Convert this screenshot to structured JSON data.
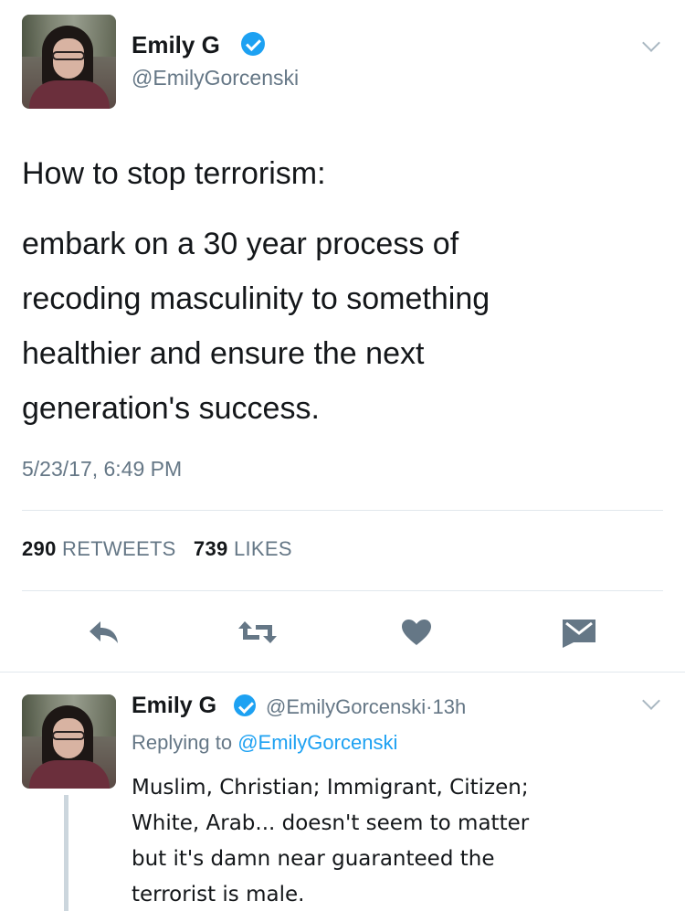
{
  "main_tweet": {
    "author": {
      "name": "Emily G",
      "handle": "@EmilyGorcenski",
      "verified": true
    },
    "title_line": "How to stop terrorism:",
    "body_lines": [
      "embark on a 30 year process of",
      "recoding masculinity to something",
      "healthier and ensure the next",
      "generation's success."
    ],
    "timestamp": "5/23/17, 6:49 PM",
    "stats": {
      "retweets_count": "290",
      "retweets_label": "RETWEETS",
      "likes_count": "739",
      "likes_label": "LIKES"
    },
    "actions": [
      "reply-icon",
      "retweet-icon",
      "heart-icon",
      "envelope-icon"
    ]
  },
  "reply_tweet": {
    "author": {
      "name": "Emily G",
      "handle": "@EmilyGorcenski",
      "verified": true
    },
    "time_sep": "·",
    "time": "13h",
    "replying_prefix": "Replying to",
    "replying_to": "@EmilyGorcenski",
    "body_lines": [
      "Muslim, Christian; Immigrant, Citizen;",
      "White, Arab... doesn't seem to matter",
      "but it's damn near guaranteed the",
      "terrorist is male."
    ]
  },
  "colors": {
    "primary_text": "#14171a",
    "secondary_text": "#657786",
    "link": "#1da1f2",
    "verified_badge": "#1da1f2",
    "action_icon": "#657786",
    "divider": "#e1e8ed"
  }
}
